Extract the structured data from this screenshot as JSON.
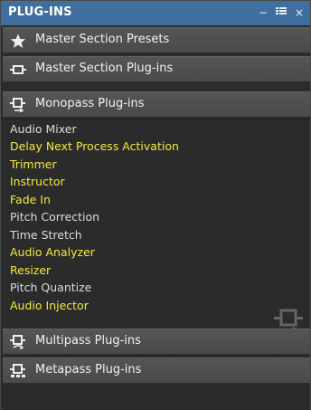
{
  "panel": {
    "title": "PLUG-INS",
    "controls": {
      "minimize": "−",
      "menu": "▦",
      "close": "×"
    }
  },
  "sections": [
    {
      "label": "Master Section Presets",
      "icon": "star-icon"
    },
    {
      "label": "Master Section Plug-ins",
      "icon": "plugin-connector-icon"
    },
    {
      "label": "Monopass Plug-ins",
      "icon": "monopass-plugin-icon"
    },
    {
      "label": "Multipass Plug-ins",
      "icon": "multipass-plugin-icon"
    },
    {
      "label": "Metapass Plug-ins",
      "icon": "metapass-plugin-icon"
    }
  ],
  "monopass_items": [
    {
      "label": "Audio Mixer",
      "color": "#dcdcdc"
    },
    {
      "label": "Delay Next Process Activation",
      "color": "#f3ea3e"
    },
    {
      "label": "Trimmer",
      "color": "#f3ea3e"
    },
    {
      "label": "Instructor",
      "color": "#f3ea3e"
    },
    {
      "label": "Fade In",
      "color": "#f3ea3e"
    },
    {
      "label": "Pitch Correction",
      "color": "#dcdcdc"
    },
    {
      "label": "Time Stretch",
      "color": "#dcdcdc"
    },
    {
      "label": "Audio Analyzer",
      "color": "#f3ea3e"
    },
    {
      "label": "Resizer",
      "color": "#f3ea3e"
    },
    {
      "label": "Pitch Quantize",
      "color": "#dcdcdc"
    },
    {
      "label": "Audio Injector",
      "color": "#f3ea3e"
    }
  ],
  "colors": {
    "titlebar": "#3f6f9e",
    "section": "#4f4f4f",
    "background": "#2b2b2b",
    "highlight_text": "#f3ea3e",
    "normal_text": "#dcdcdc"
  }
}
